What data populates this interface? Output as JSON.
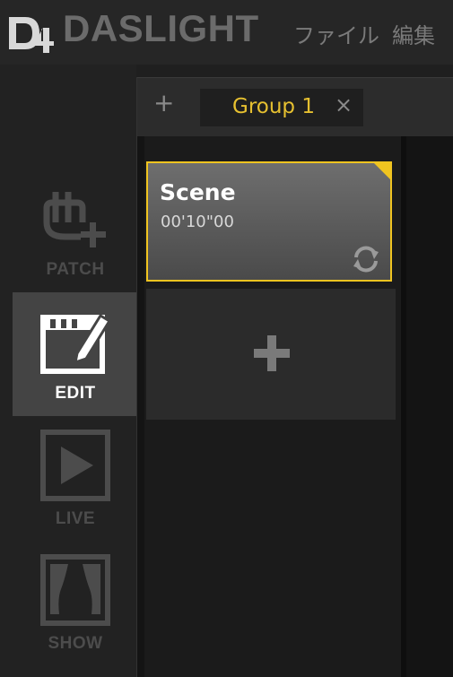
{
  "app": {
    "logo_text": "DASLIGHT",
    "logo_mark": "D4"
  },
  "menu": {
    "file_label": "ファイル",
    "edit_label": "編集"
  },
  "nav": {
    "patch_label": "PATCH",
    "edit_label": "EDIT",
    "live_label": "LIVE",
    "show_label": "SHOW",
    "active": "EDIT"
  },
  "tabs": {
    "add_symbol": "+",
    "items": [
      {
        "label": "Group 1",
        "close_symbol": "×",
        "active": true
      }
    ]
  },
  "scenes": [
    {
      "name": "Scene",
      "duration": "00'10\"00",
      "selected": true,
      "icon": "loop-icon"
    }
  ],
  "add_scene": {
    "icon": "plus-icon"
  },
  "colors": {
    "accent": "#f0c420",
    "nav_active_bg": "#444444",
    "background": "#1f1f1f"
  }
}
